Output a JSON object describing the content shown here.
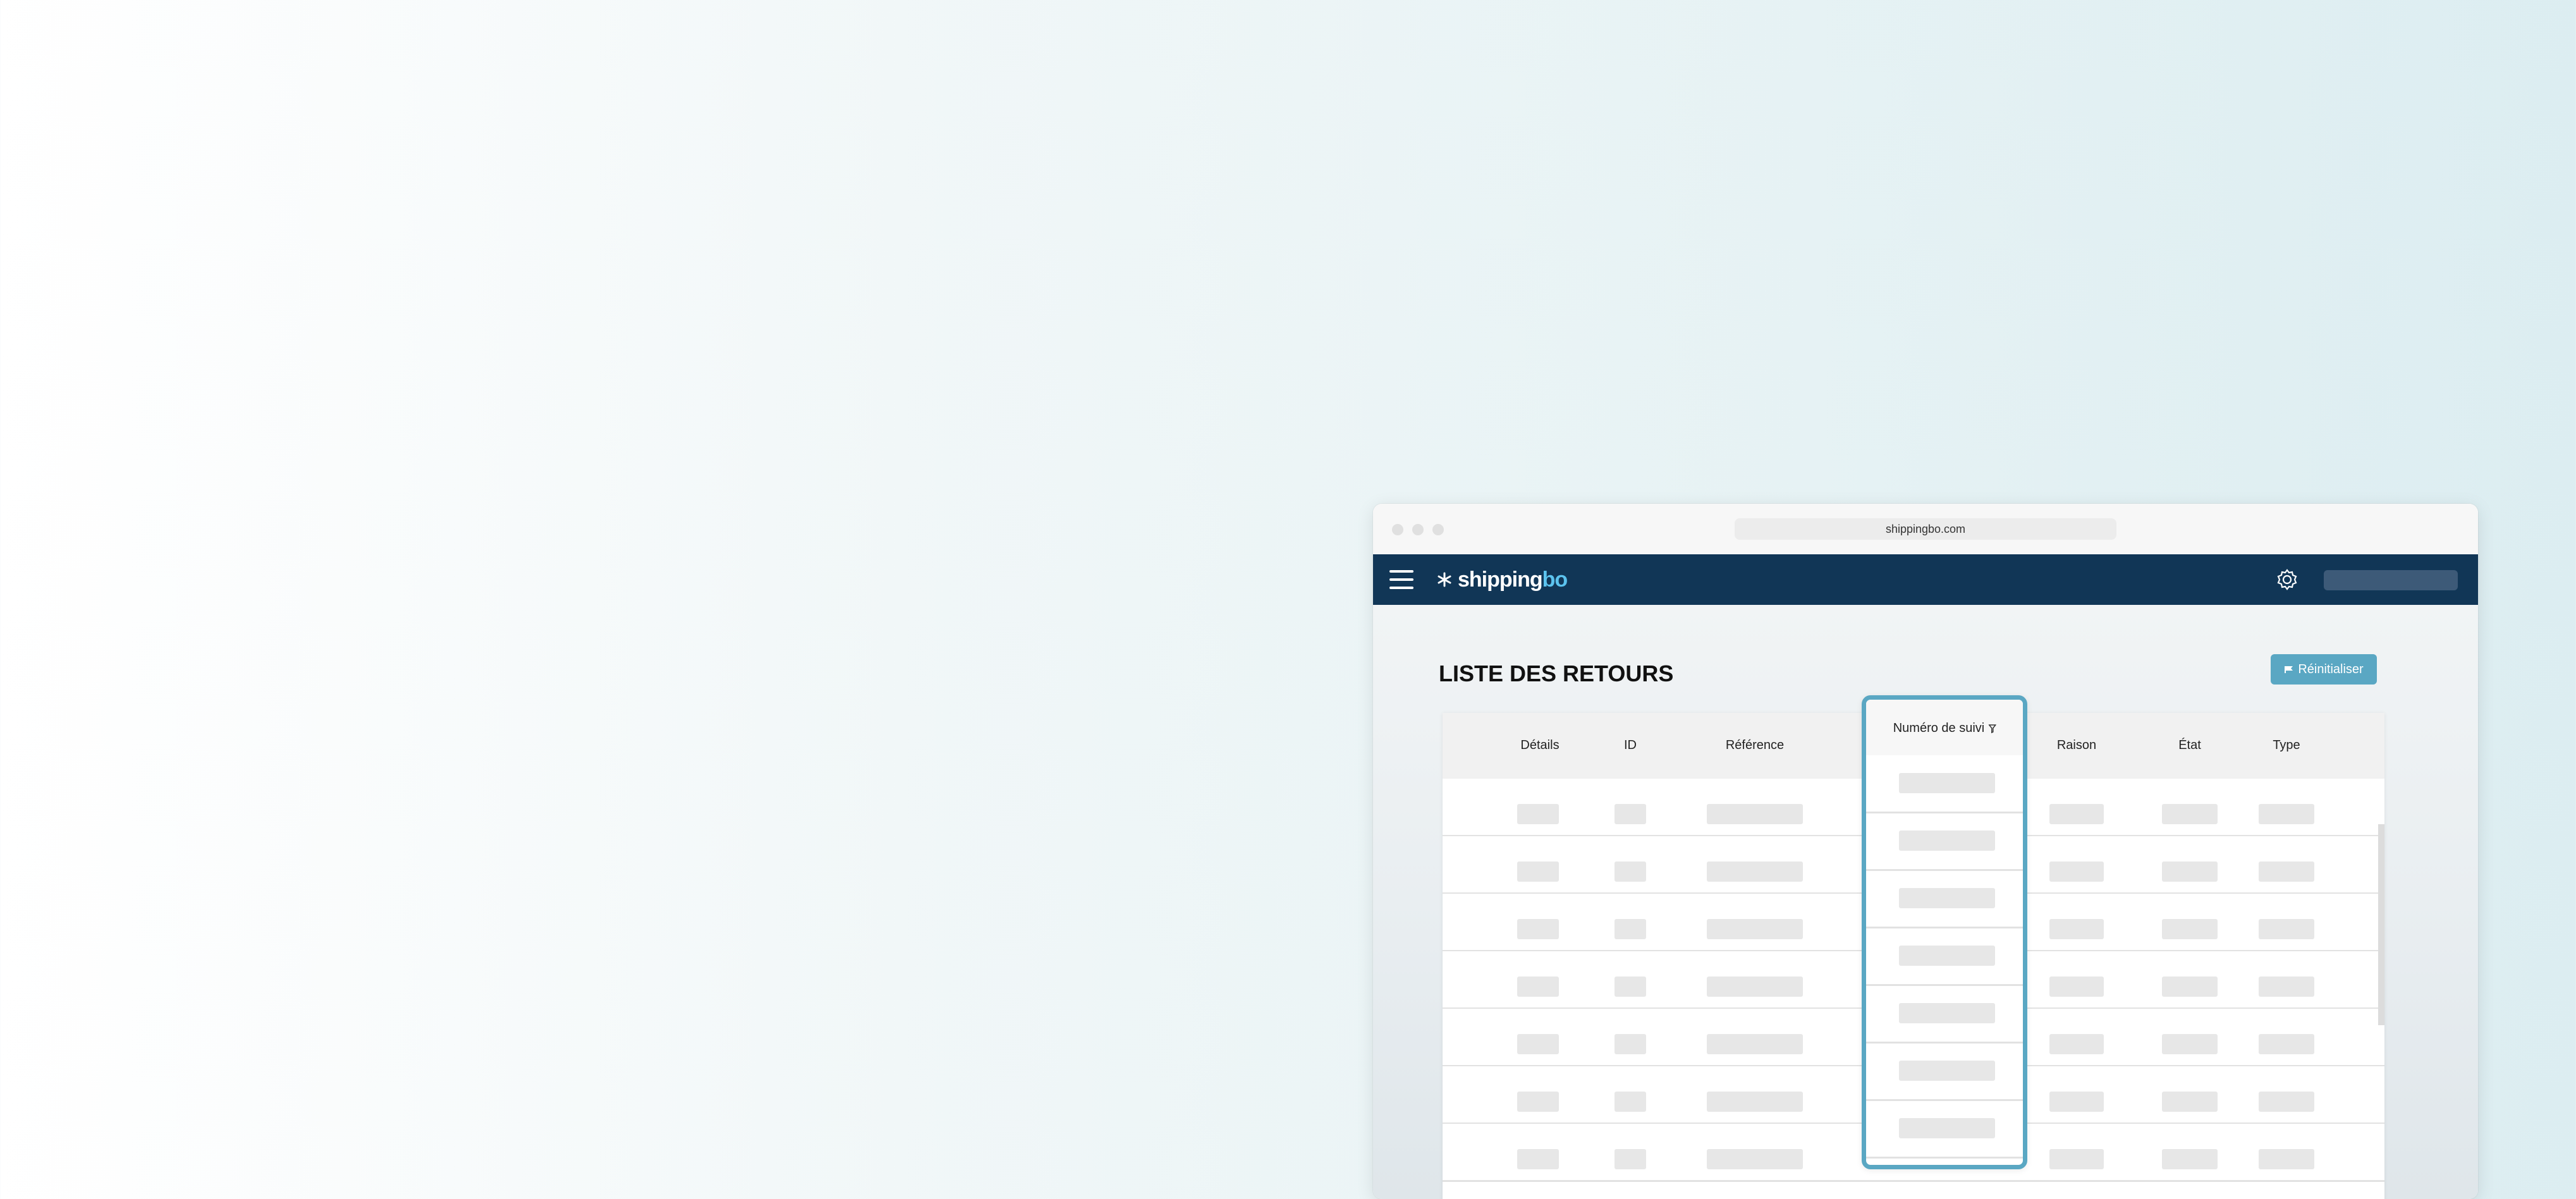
{
  "browser": {
    "url": "shippingbo.com"
  },
  "appbar": {
    "logo_main": "shipping",
    "logo_accent": "bo"
  },
  "page": {
    "title": "LISTE DES RETOURS",
    "reset_label": "Réinitialiser"
  },
  "table": {
    "columns": [
      "Détails",
      "ID",
      "Référence",
      "Numéro de suivi",
      "Raison",
      "État",
      "Type"
    ],
    "highlighted_column": "Numéro de suivi",
    "rows": 7
  },
  "colors": {
    "navbar": "#113656",
    "accent": "#5aa7c3",
    "logo_accent": "#5cc3ee"
  }
}
